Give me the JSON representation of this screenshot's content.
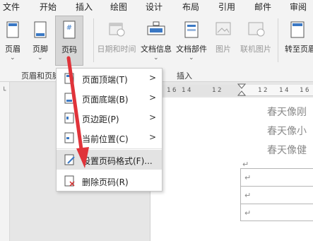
{
  "tabs": [
    "文件",
    "开始",
    "插入",
    "绘图",
    "设计",
    "布局",
    "引用",
    "邮件",
    "审阅"
  ],
  "ribbon": {
    "header": "页眉",
    "footer": "页脚",
    "page_number": "页码",
    "date_time": "日期和时间",
    "doc_info": "文档信息",
    "doc_parts": "文档部件",
    "picture": "图片",
    "online_picture": "联机图片",
    "goto_header": "转至页眉",
    "group_header_footer": "页眉和页脚",
    "group_insert": "插入"
  },
  "menu": {
    "items": [
      {
        "label": "页面顶端(T)",
        "submenu": true
      },
      {
        "label": "页面底端(B)",
        "submenu": true
      },
      {
        "label": "页边距(P)",
        "submenu": true
      },
      {
        "label": "当前位置(C)",
        "submenu": true
      },
      {
        "label": "设置页码格式(F)...",
        "submenu": false
      },
      {
        "label": "删除页码(R)",
        "submenu": false
      }
    ],
    "submenu_arrow": ">"
  },
  "ruler": {
    "ticks": [
      "1",
      "6",
      "1",
      "4",
      "1",
      "2",
      "1",
      "2",
      "1",
      "4",
      "1",
      "6"
    ]
  },
  "document": {
    "lines": [
      "春天像刚",
      "春天像小",
      "春天像健"
    ],
    "paragraph_mark": "↵"
  },
  "colors": {
    "arrow": "#e0333a",
    "highlight": "#e3e3e3",
    "ribbon_bg": "#f3f3f3"
  }
}
